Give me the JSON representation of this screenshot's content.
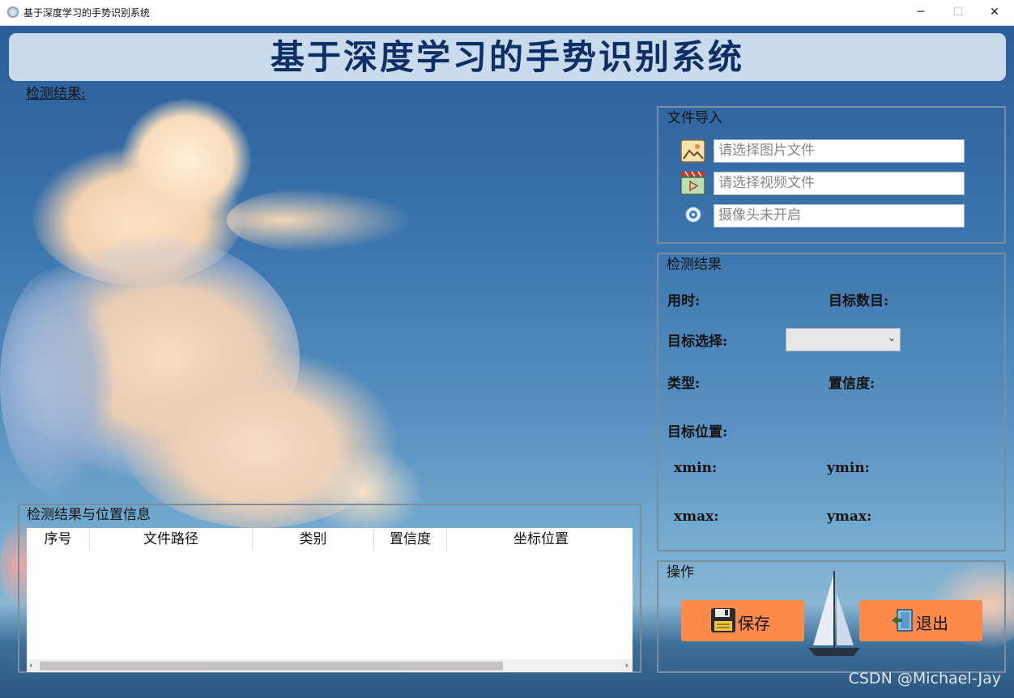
{
  "window": {
    "title": "基于深度学习的手势识别系统",
    "minimize": "─",
    "maximize": "☐",
    "close": "✕"
  },
  "header": {
    "title": "基于深度学习的手势识别系统"
  },
  "preview": {
    "label": "检测结果:"
  },
  "file_import": {
    "title": "文件导入",
    "image_placeholder": "请选择图片文件",
    "video_placeholder": "请选择视频文件",
    "camera_placeholder": "摄像头未开启",
    "icons": [
      "image-icon",
      "video-icon",
      "camera-icon"
    ]
  },
  "result": {
    "title": "检测结果",
    "time_label": "用时:",
    "count_label": "目标数目:",
    "select_label": "目标选择:",
    "select_value": "",
    "type_label": "类型:",
    "conf_label": "置信度:",
    "pos_label": "目标位置:",
    "xmin_label": "xmin:",
    "ymin_label": "ymin:",
    "xmax_label": "xmax:",
    "ymax_label": "ymax:"
  },
  "ops": {
    "title": "操作",
    "save_label": "保存",
    "exit_label": "退出"
  },
  "table": {
    "title": "检测结果与位置信息",
    "columns": [
      "序号",
      "文件路径",
      "类别",
      "置信度",
      "坐标位置"
    ],
    "rows": []
  },
  "watermark": "CSDN @Michael-Jay",
  "colors": {
    "accent_button": "#fb8a4b",
    "header_text": "#0e2f66",
    "header_bg": "#d6e4f2"
  }
}
